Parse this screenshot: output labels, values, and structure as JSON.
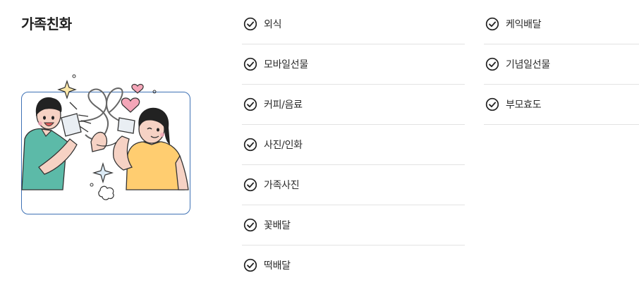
{
  "section": {
    "title": "가족친화"
  },
  "categories": {
    "column1": [
      "외식",
      "모바일선물",
      "커피/음료",
      "사진/인화",
      "가족사진",
      "꽃배달",
      "떡배달"
    ],
    "column2": [
      "케익배달",
      "기념일선물",
      "부모효도"
    ]
  },
  "icons": {
    "item": "check-circle-icon",
    "illustration": "string-phone-couple-illustration"
  },
  "colors": {
    "card_border": "#3f72b5",
    "shirt_left": "#5cbaa8",
    "shirt_right": "#ffcd70",
    "heart": "#f4a6b8",
    "skin": "#f6d2c4"
  }
}
